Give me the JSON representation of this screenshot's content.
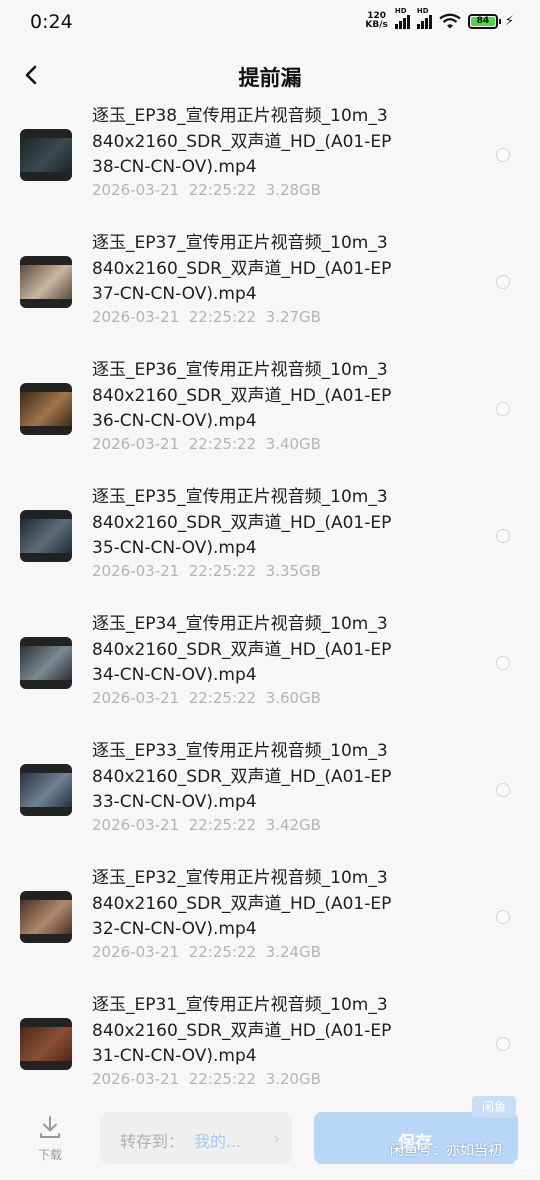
{
  "status_bar": {
    "time": "0:24",
    "net_speed_value": "120",
    "net_speed_unit": "KB/s",
    "signal_label": "HD",
    "battery": "84",
    "battery_icon": "battery-icon",
    "wifi_icon": "wifi-icon"
  },
  "header": {
    "title": "提前漏",
    "back_icon": "back-arrow-icon"
  },
  "files": [
    {
      "name": "逐玉_EP38_宣传用正片视音频_10m_3840x2160_SDR_双声道_HD_(A01-EP38-CN-CN-OV).mp4",
      "date": "2026-03-21",
      "time": "22:25:22",
      "size": "3.28GB",
      "thumb_colors": [
        "#1b2428",
        "#3a4a50"
      ]
    },
    {
      "name": "逐玉_EP37_宣传用正片视音频_10m_3840x2160_SDR_双声道_HD_(A01-EP37-CN-CN-OV).mp4",
      "date": "2026-03-21",
      "time": "22:25:22",
      "size": "3.27GB",
      "thumb_colors": [
        "#5b4a3d",
        "#c9b7a3"
      ]
    },
    {
      "name": "逐玉_EP36_宣传用正片视音频_10m_3840x2160_SDR_双声道_HD_(A01-EP36-CN-CN-OV).mp4",
      "date": "2026-03-21",
      "time": "22:25:22",
      "size": "3.40GB",
      "thumb_colors": [
        "#3b2a1c",
        "#a0754a"
      ]
    },
    {
      "name": "逐玉_EP35_宣传用正片视音频_10m_3840x2160_SDR_双声道_HD_(A01-EP35-CN-CN-OV).mp4",
      "date": "2026-03-21",
      "time": "22:25:22",
      "size": "3.35GB",
      "thumb_colors": [
        "#1e2a33",
        "#5d6e79"
      ]
    },
    {
      "name": "逐玉_EP34_宣传用正片视音频_10m_3840x2160_SDR_双声道_HD_(A01-EP34-CN-CN-OV).mp4",
      "date": "2026-03-21",
      "time": "22:25:22",
      "size": "3.60GB",
      "thumb_colors": [
        "#2a3238",
        "#7b8a93"
      ]
    },
    {
      "name": "逐玉_EP33_宣传用正片视音频_10m_3840x2160_SDR_双声道_HD_(A01-EP33-CN-CN-OV).mp4",
      "date": "2026-03-21",
      "time": "22:25:22",
      "size": "3.42GB",
      "thumb_colors": [
        "#26313d",
        "#6f8294"
      ]
    },
    {
      "name": "逐玉_EP32_宣传用正片视音频_10m_3840x2160_SDR_双声道_HD_(A01-EP32-CN-CN-OV).mp4",
      "date": "2026-03-21",
      "time": "22:25:22",
      "size": "3.24GB",
      "thumb_colors": [
        "#4a2f24",
        "#b08870"
      ]
    },
    {
      "name": "逐玉_EP31_宣传用正片视音频_10m_3840x2160_SDR_双声道_HD_(A01-EP31-CN-CN-OV).mp4",
      "date": "2026-03-21",
      "time": "22:25:22",
      "size": "3.20GB",
      "thumb_colors": [
        "#4b2718",
        "#8a4f33"
      ]
    }
  ],
  "bottom_bar": {
    "download_label": "下载",
    "download_icon": "download-icon",
    "transfer_label": "转存到：",
    "transfer_value": "我的...",
    "transfer_chevron": "›",
    "save_label": "保存",
    "watermark_badge": "闲鱼",
    "watermark_text": "闲鱼号：亦如当初",
    "watermark_corner": "闲鱼"
  },
  "colors": {
    "background": "#f7f7f7",
    "accent": "#b8d6f8",
    "meta_text": "#b4b4b4",
    "battery_green": "#4cd64a"
  }
}
